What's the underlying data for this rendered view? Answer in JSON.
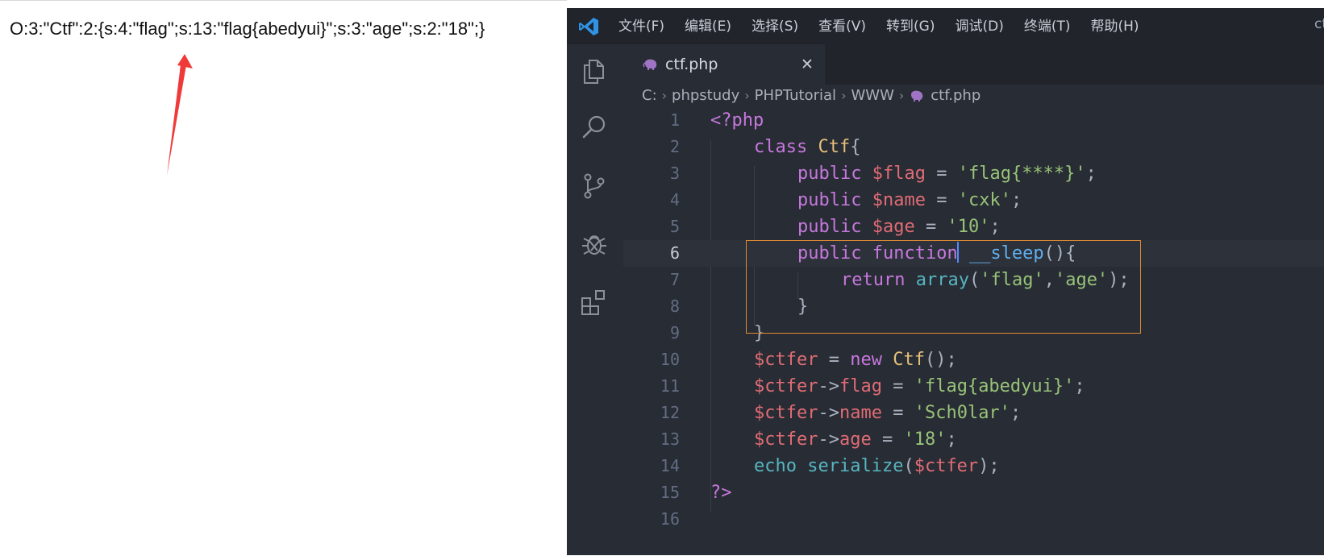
{
  "browser": {
    "output": "O:3:\"Ctf\":2:{s:4:\"flag\";s:13:\"flag{abedyui}\";s:3:\"age\";s:2:\"18\";}"
  },
  "vscode": {
    "menu": [
      "文件(F)",
      "编辑(E)",
      "选择(S)",
      "查看(V)",
      "转到(G)",
      "调试(D)",
      "终端(T)",
      "帮助(H)"
    ],
    "window_title": "ct",
    "tab": {
      "label": "ctf.php",
      "close": "✕"
    },
    "breadcrumb": [
      "C:",
      "phpstudy",
      "PHPTutorial",
      "WWW",
      "ctf.php"
    ],
    "line_numbers": [
      "1",
      "2",
      "3",
      "4",
      "5",
      "6",
      "7",
      "8",
      "9",
      "10",
      "11",
      "12",
      "13",
      "14",
      "15",
      "16"
    ],
    "code": {
      "l1": {
        "open": "<?php"
      },
      "l2": {
        "kw": "class",
        "name": "Ctf",
        "brace": "{"
      },
      "l3": {
        "kw": "public",
        "var": "$flag",
        "eq": "=",
        "str": "'flag{****}'",
        "end": ";"
      },
      "l4": {
        "kw": "public",
        "var": "$name",
        "eq": "=",
        "str": "'cxk'",
        "end": ";"
      },
      "l5": {
        "kw": "public",
        "var": "$age",
        "eq": "=",
        "str": "'10'",
        "end": ";"
      },
      "l6": {
        "kw": "public",
        "kw2": "function",
        "fn": "__sleep",
        "paren": "(){"
      },
      "l7": {
        "kw": "return",
        "fn": "array",
        "p1": "(",
        "s1": "'flag'",
        "comma": ",",
        "s2": "'age'",
        "p2": ");"
      },
      "l8": {
        "brace": "}"
      },
      "l9": {
        "brace": "}"
      },
      "l10": {
        "var": "$ctfer",
        "eq": "=",
        "kw": "new",
        "cls": "Ctf",
        "end": "();"
      },
      "l11": {
        "var": "$ctfer",
        "arrow": "->",
        "prop": "flag",
        "eq": "=",
        "str": "'flag{abedyui}'",
        "end": ";"
      },
      "l12": {
        "var": "$ctfer",
        "arrow": "->",
        "prop": "name",
        "eq": "=",
        "str": "'Sch0lar'",
        "end": ";"
      },
      "l13": {
        "var": "$ctfer",
        "arrow": "->",
        "prop": "age",
        "eq": "=",
        "str": "'18'",
        "end": ";"
      },
      "l14": {
        "kw": "echo",
        "fn": "serialize",
        "p1": "(",
        "var": "$ctfer",
        "p2": ");"
      },
      "l15": {
        "close": "?>"
      }
    }
  },
  "colors": {
    "keyword": "#c678dd",
    "class": "#e5c07b",
    "variable": "#e06c75",
    "string": "#98c379",
    "function": "#61afef",
    "annotation_box": "#e08a34",
    "arrow": "#f03a3a"
  }
}
